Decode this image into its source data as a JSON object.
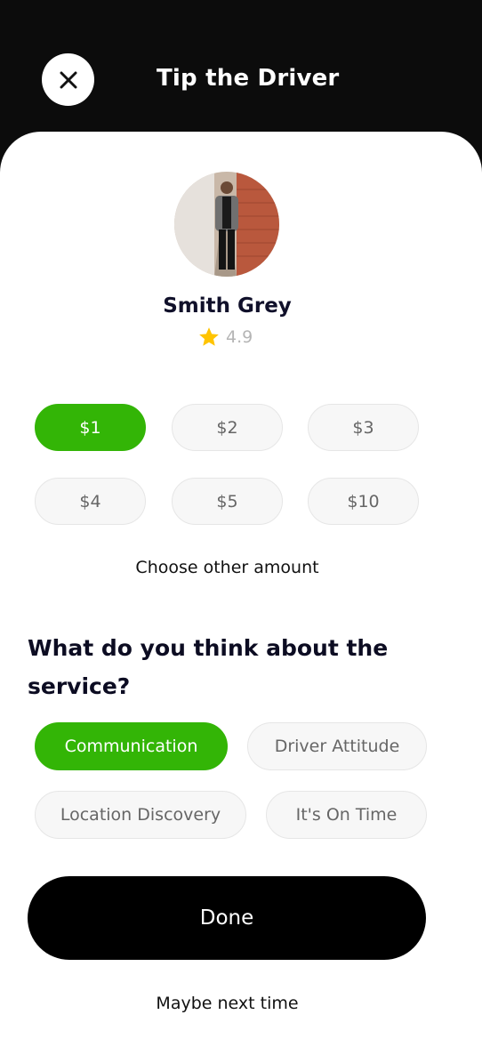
{
  "header": {
    "title": "Tip the Driver",
    "close_icon": "close-icon"
  },
  "driver": {
    "name": "Smith Grey",
    "rating": "4.9",
    "rating_icon": "star-icon",
    "avatar_icon": "driver-photo"
  },
  "tips": {
    "options": [
      "$1",
      "$2",
      "$3",
      "$4",
      "$5",
      "$10"
    ],
    "selected": "$1",
    "other_amount_label": "Choose other amount"
  },
  "feedback": {
    "question": "What do you think about the service?",
    "tags": [
      "Communication",
      "Driver Attitude",
      "Location Discovery",
      "It's On Time"
    ],
    "selected": "Communication"
  },
  "actions": {
    "done_label": "Done",
    "skip_label": "Maybe next time"
  },
  "colors": {
    "accent": "#33b506",
    "header_bg": "#0c0c0c",
    "star": "#ffc400",
    "button_dark": "#000000"
  }
}
